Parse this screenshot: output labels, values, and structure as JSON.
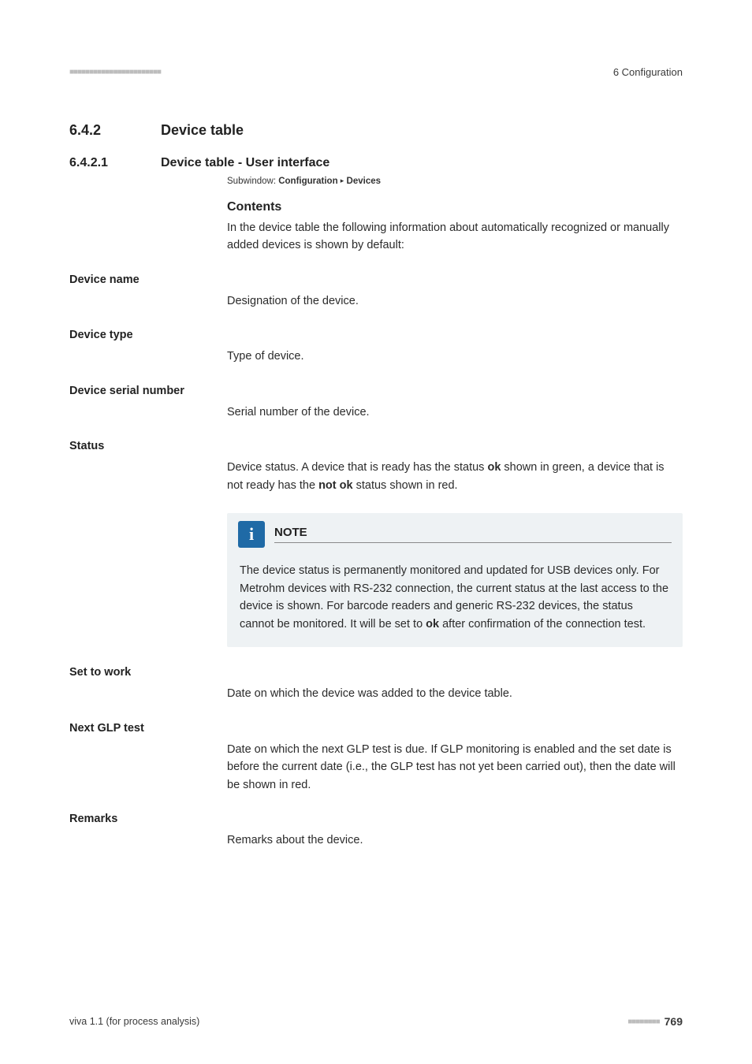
{
  "header": {
    "chapter": "6 Configuration"
  },
  "section": {
    "num": "6.4.2",
    "title": "Device table"
  },
  "subsection": {
    "num": "6.4.2.1",
    "title": "Device table - User interface"
  },
  "subwindow": {
    "label": "Subwindow:",
    "path1": "Configuration",
    "path2": "Devices"
  },
  "contents": {
    "heading": "Contents",
    "para": "In the device table the following information about automatically recognized or manually added devices is shown by default:"
  },
  "fields": {
    "device_name": {
      "label": "Device name",
      "body": "Designation of the device."
    },
    "device_type": {
      "label": "Device type",
      "body": "Type of device."
    },
    "serial": {
      "label": "Device serial number",
      "body": "Serial number of the device."
    },
    "status": {
      "label": "Status",
      "body_pre": "Device status. A device that is ready has the status ",
      "ok": "ok",
      "body_mid": " shown in green, a device that is not ready has the ",
      "notok": "not ok",
      "body_post": " status shown in red."
    },
    "set_to_work": {
      "label": "Set to work",
      "body": "Date on which the device was added to the device table."
    },
    "next_glp": {
      "label": "Next GLP test",
      "body": "Date on which the next GLP test is due. If GLP monitoring is enabled and the set date is before the current date (i.e., the GLP test has not yet been carried out), then the date will be shown in red."
    },
    "remarks": {
      "label": "Remarks",
      "body": "Remarks about the device."
    }
  },
  "note": {
    "title": "NOTE",
    "body_pre": "The device status is permanently monitored and updated for USB devices only. For Metrohm devices with RS-232 connection, the current status at the last access to the device is shown. For barcode readers and generic RS-232 devices, the status cannot be monitored. It will be set to ",
    "ok": "ok",
    "body_post": " after confirmation of the connection test."
  },
  "footer": {
    "left": "viva 1.1 (for process analysis)",
    "page": "769"
  }
}
